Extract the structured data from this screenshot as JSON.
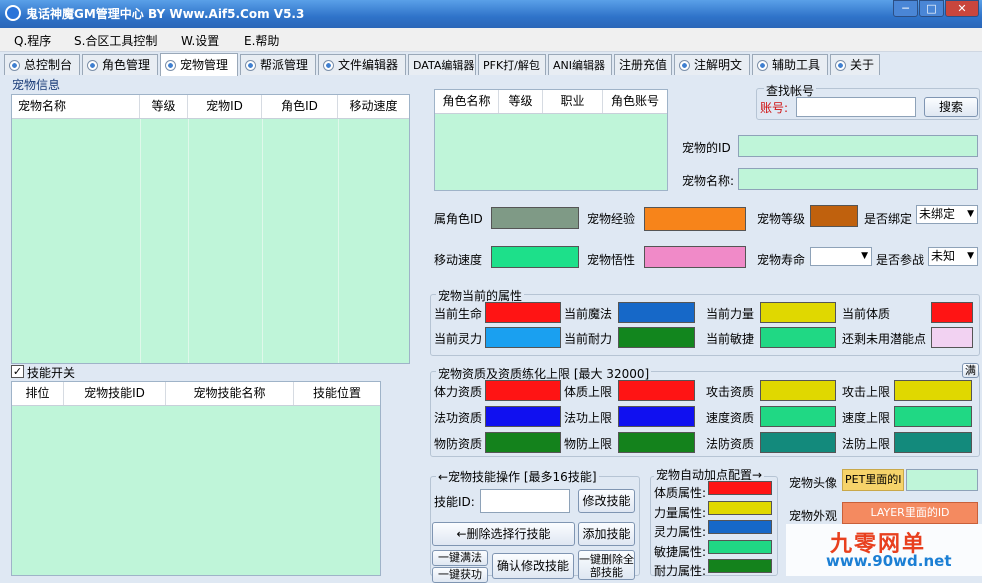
{
  "window": {
    "title": "鬼话神魔GM管理中心 BY Www.Aif5.Com  V5.3",
    "min_glyph": "─",
    "max_glyph": "□",
    "close_glyph": "✕"
  },
  "menu": [
    "Q.程序",
    "S.合区工具控制",
    "W.设置",
    "E.帮助"
  ],
  "tabs": [
    "总控制台",
    "角色管理",
    "宠物管理",
    "帮派管理",
    "文件编辑器",
    "DATA编辑器",
    "PFK打/解包",
    "ANI编辑器",
    "注册充值",
    "注解明文",
    "辅助工具",
    "关于"
  ],
  "pet_info": {
    "label": "宠物信息",
    "columns": [
      "宠物名称",
      "等级",
      "宠物ID",
      "角色ID",
      "移动速度"
    ]
  },
  "skills": {
    "toggle_label": "技能开关",
    "columns": [
      "排位",
      "宠物技能ID",
      "宠物技能名称",
      "技能位置"
    ]
  },
  "role_table": {
    "columns": [
      "角色名称",
      "等级",
      "职业",
      "角色账号"
    ]
  },
  "find_account": {
    "label": "查找帐号",
    "account_label": "账号:",
    "search_button": "搜索"
  },
  "pet_fields": {
    "pet_id_label": "宠物的ID",
    "pet_name_label": "宠物名称:",
    "owner_id_label": "属角色ID",
    "exp_label": "宠物经验",
    "level_label": "宠物等级",
    "bound_label": "是否绑定",
    "bound_value": "未绑定",
    "speed_label": "移动速度",
    "savvy_label": "宠物悟性",
    "life_label": "宠物寿命",
    "battle_label": "是否参战",
    "battle_value": "未知"
  },
  "current_attrs": {
    "label": "宠物当前的属性",
    "items": [
      "当前生命",
      "当前魔法",
      "当前力量",
      "当前体质",
      "当前灵力",
      "当前耐力",
      "当前敏捷",
      "还剩未用潜能点"
    ]
  },
  "aptitude": {
    "label": "宠物资质及资质练化上限 [最大 32000]",
    "full_button": "满",
    "items": [
      "体力资质",
      "体质上限",
      "攻击资质",
      "攻击上限",
      "法功资质",
      "法功上限",
      "速度资质",
      "速度上限",
      "物防资质",
      "物防上限",
      "法防资质",
      "法防上限"
    ]
  },
  "skill_ops": {
    "label": "←宠物技能操作 [最多16技能]",
    "skill_id_label": "技能ID:",
    "modify_button": "修改技能",
    "delete_selected_button": "←删除选择行技能",
    "add_button": "添加技能",
    "one_click_full_button": "一键满法",
    "one_click_learn_button": "一键获功",
    "confirm_modify_button": "确认修改技能",
    "delete_all_button": "一键删除全部技能"
  },
  "auto_points": {
    "label": "宠物自动加点配置→",
    "items": [
      "体质属性:",
      "力量属性:",
      "灵力属性:",
      "敏捷属性:",
      "耐力属性:"
    ]
  },
  "appearance": {
    "avatar_label": "宠物头像",
    "avatar_value": "PET里面的I",
    "look_label": "宠物外观",
    "look_value": "LAYER里面的ID"
  },
  "watermark": {
    "line1": "九零网单",
    "line2": "www.90wd.net"
  },
  "colors": {
    "owner_id": "#7f9a86",
    "exp": "#f7841a",
    "level": "#c0610d",
    "speed": "#1de08a",
    "savvy": "#f08ac8",
    "current": [
      "#ff1414",
      "#1668c8",
      "#e0d800",
      "#ff1414",
      "#1aa0f0",
      "#12861e",
      "#20d884",
      "#f2d2f2"
    ],
    "aptitude": [
      "#ff1414",
      "#ff1414",
      "#e0d800",
      "#e0d800",
      "#1010f0",
      "#1010f0",
      "#20d884",
      "#20d884",
      "#14821c",
      "#14821c",
      "#138a7c",
      "#138a7c"
    ],
    "auto": [
      "#ff1414",
      "#e0d800",
      "#1668c8",
      "#20d884",
      "#14821c"
    ]
  }
}
